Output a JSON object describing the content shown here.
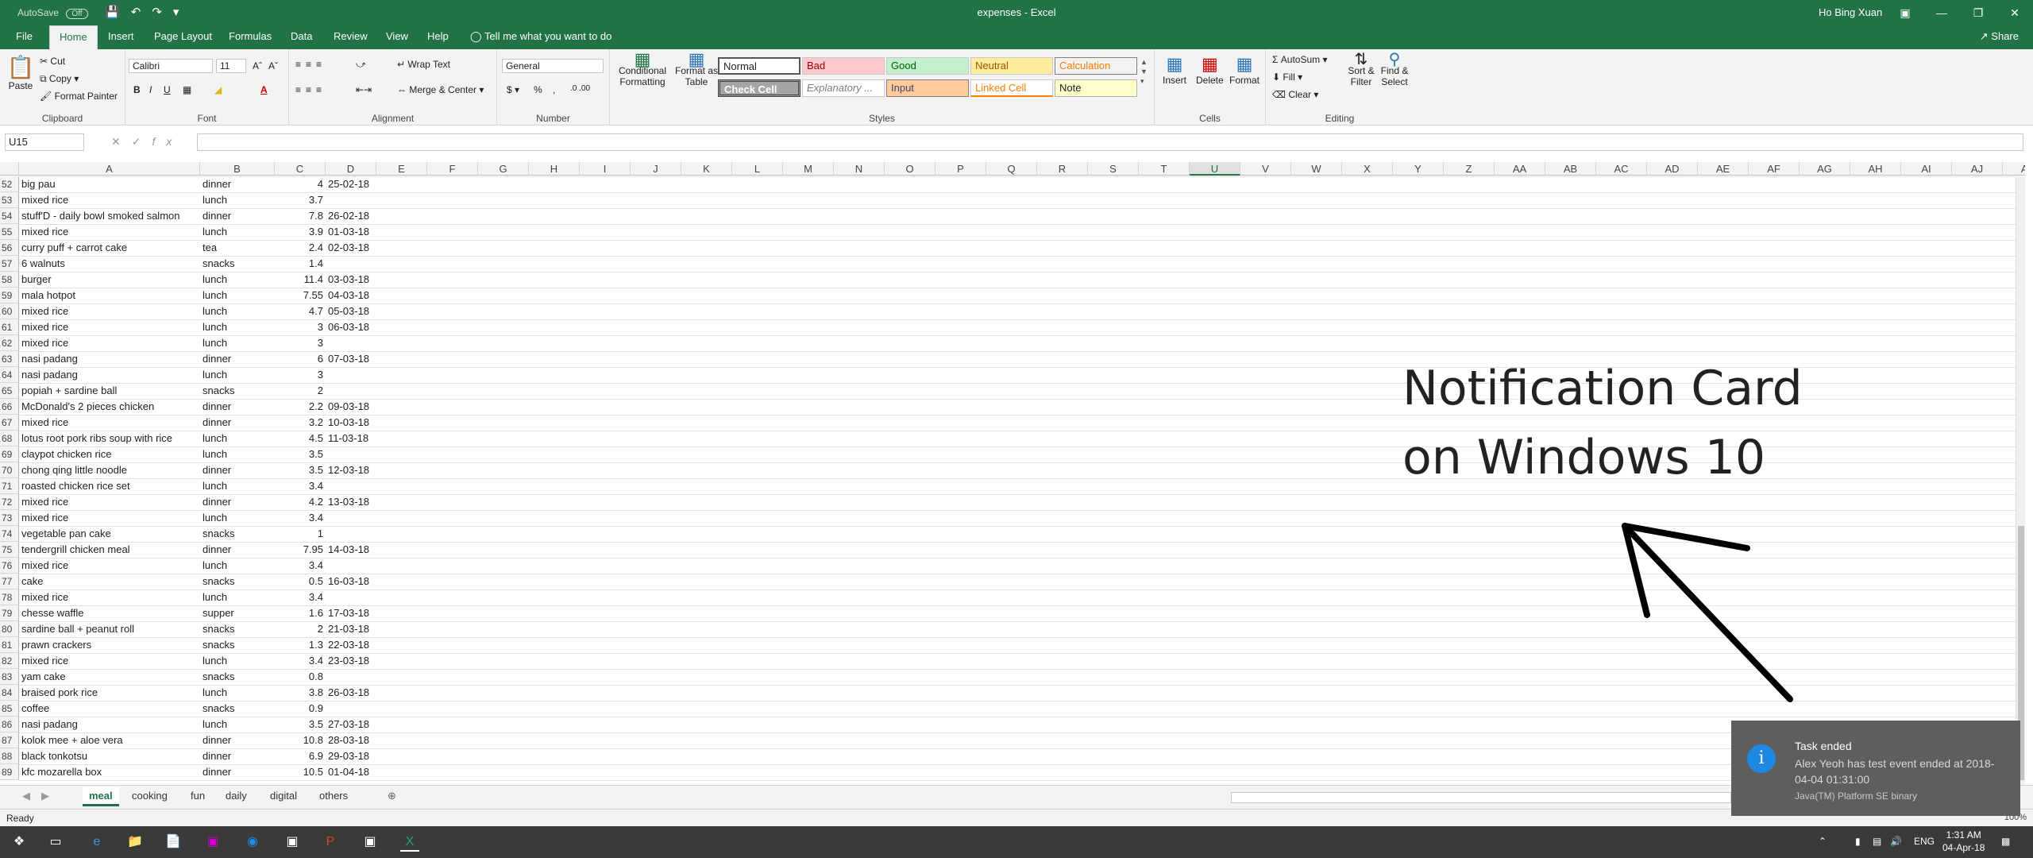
{
  "titlebar": {
    "autosave": "AutoSave",
    "autosave_state": "Off",
    "title": "expenses - Excel",
    "user": "Ho Bing Xuan"
  },
  "tabs": [
    "File",
    "Home",
    "Insert",
    "Page Layout",
    "Formulas",
    "Data",
    "Review",
    "View",
    "Help"
  ],
  "tell_me": "Tell me what you want to do",
  "share": "Share",
  "ribbon": {
    "clipboard": {
      "paste": "Paste",
      "cut": "Cut",
      "copy": "Copy",
      "format_painter": "Format Painter",
      "label": "Clipboard"
    },
    "font": {
      "name": "Calibri",
      "size": "11",
      "label": "Font"
    },
    "alignment": {
      "wrap": "Wrap Text",
      "merge": "Merge & Center",
      "label": "Alignment"
    },
    "number": {
      "format": "General",
      "label": "Number"
    },
    "styles": {
      "conditional": "Conditional Formatting",
      "format_table": "Format as Table",
      "cells": [
        "Normal",
        "Bad",
        "Good",
        "Neutral",
        "Calculation",
        "Check Cell",
        "Explanatory ...",
        "Input",
        "Linked Cell",
        "Note"
      ],
      "label": "Styles"
    },
    "cells": {
      "insert": "Insert",
      "delete": "Delete",
      "format": "Format",
      "label": "Cells"
    },
    "editing": {
      "autosum": "AutoSum",
      "fill": "Fill",
      "clear": "Clear",
      "sort": "Sort & Filter",
      "find": "Find & Select",
      "label": "Editing"
    }
  },
  "formula_bar": {
    "name_box": "U15",
    "fx": "fx",
    "formula": ""
  },
  "columns": [
    "A",
    "B",
    "C",
    "D",
    "E",
    "F",
    "G",
    "H",
    "I",
    "J",
    "K",
    "L",
    "M",
    "N",
    "O",
    "P",
    "Q",
    "R",
    "S",
    "T",
    "U",
    "V",
    "W",
    "X",
    "Y",
    "Z",
    "AA",
    "AB",
    "AC",
    "AD",
    "AE",
    "AF",
    "AG",
    "AH",
    "AI",
    "AJ",
    "AK"
  ],
  "rows": [
    {
      "n": "52",
      "a": "big pau",
      "b": "dinner",
      "c": "4",
      "d": "25-02-18"
    },
    {
      "n": "53",
      "a": "mixed rice",
      "b": "lunch",
      "c": "3.7",
      "d": ""
    },
    {
      "n": "54",
      "a": "stuff'D - daily bowl smoked salmon",
      "b": "dinner",
      "c": "7.8",
      "d": "26-02-18"
    },
    {
      "n": "55",
      "a": "mixed rice",
      "b": "lunch",
      "c": "3.9",
      "d": "01-03-18"
    },
    {
      "n": "56",
      "a": "curry puff + carrot cake",
      "b": "tea",
      "c": "2.4",
      "d": "02-03-18"
    },
    {
      "n": "57",
      "a": "6 walnuts",
      "b": "snacks",
      "c": "1.4",
      "d": ""
    },
    {
      "n": "58",
      "a": "burger",
      "b": "lunch",
      "c": "11.4",
      "d": "03-03-18"
    },
    {
      "n": "59",
      "a": "mala hotpot",
      "b": "lunch",
      "c": "7.55",
      "d": "04-03-18"
    },
    {
      "n": "60",
      "a": "mixed rice",
      "b": "lunch",
      "c": "4.7",
      "d": "05-03-18"
    },
    {
      "n": "61",
      "a": "mixed rice",
      "b": "lunch",
      "c": "3",
      "d": "06-03-18"
    },
    {
      "n": "62",
      "a": "mixed rice",
      "b": "lunch",
      "c": "3",
      "d": ""
    },
    {
      "n": "63",
      "a": "nasi padang",
      "b": "dinner",
      "c": "6",
      "d": "07-03-18"
    },
    {
      "n": "64",
      "a": "nasi padang",
      "b": "lunch",
      "c": "3",
      "d": ""
    },
    {
      "n": "65",
      "a": "popiah + sardine ball",
      "b": "snacks",
      "c": "2",
      "d": ""
    },
    {
      "n": "66",
      "a": "McDonald's 2 pieces chicken",
      "b": "dinner",
      "c": "2.2",
      "d": "09-03-18"
    },
    {
      "n": "67",
      "a": "mixed rice",
      "b": "dinner",
      "c": "3.2",
      "d": "10-03-18"
    },
    {
      "n": "68",
      "a": "lotus root pork ribs soup with rice",
      "b": "lunch",
      "c": "4.5",
      "d": "11-03-18"
    },
    {
      "n": "69",
      "a": "claypot chicken rice",
      "b": "lunch",
      "c": "3.5",
      "d": ""
    },
    {
      "n": "70",
      "a": "chong qing little noodle",
      "b": "dinner",
      "c": "3.5",
      "d": "12-03-18"
    },
    {
      "n": "71",
      "a": "roasted chicken rice set",
      "b": "lunch",
      "c": "3.4",
      "d": ""
    },
    {
      "n": "72",
      "a": "mixed rice",
      "b": "dinner",
      "c": "4.2",
      "d": "13-03-18"
    },
    {
      "n": "73",
      "a": "mixed rice",
      "b": "lunch",
      "c": "3.4",
      "d": ""
    },
    {
      "n": "74",
      "a": "vegetable pan cake",
      "b": "snacks",
      "c": "1",
      "d": ""
    },
    {
      "n": "75",
      "a": "tendergrill chicken meal",
      "b": "dinner",
      "c": "7.95",
      "d": "14-03-18"
    },
    {
      "n": "76",
      "a": "mixed rice",
      "b": "lunch",
      "c": "3.4",
      "d": ""
    },
    {
      "n": "77",
      "a": "cake",
      "b": "snacks",
      "c": "0.5",
      "d": "16-03-18"
    },
    {
      "n": "78",
      "a": "mixed rice",
      "b": "lunch",
      "c": "3.4",
      "d": ""
    },
    {
      "n": "79",
      "a": "chesse waffle",
      "b": "supper",
      "c": "1.6",
      "d": "17-03-18"
    },
    {
      "n": "80",
      "a": "sardine ball + peanut roll",
      "b": "snacks",
      "c": "2",
      "d": "21-03-18"
    },
    {
      "n": "81",
      "a": "prawn crackers",
      "b": "snacks",
      "c": "1.3",
      "d": "22-03-18"
    },
    {
      "n": "82",
      "a": "mixed rice",
      "b": "lunch",
      "c": "3.4",
      "d": "23-03-18"
    },
    {
      "n": "83",
      "a": "yam cake",
      "b": "snacks",
      "c": "0.8",
      "d": ""
    },
    {
      "n": "84",
      "a": "braised pork rice",
      "b": "lunch",
      "c": "3.8",
      "d": "26-03-18"
    },
    {
      "n": "85",
      "a": "coffee",
      "b": "snacks",
      "c": "0.9",
      "d": ""
    },
    {
      "n": "86",
      "a": "nasi padang",
      "b": "lunch",
      "c": "3.5",
      "d": "27-03-18"
    },
    {
      "n": "87",
      "a": "kolok mee + aloe vera",
      "b": "dinner",
      "c": "10.8",
      "d": "28-03-18"
    },
    {
      "n": "88",
      "a": "black tonkotsu",
      "b": "dinner",
      "c": "6.9",
      "d": "29-03-18"
    },
    {
      "n": "89",
      "a": "kfc mozarella box",
      "b": "dinner",
      "c": "10.5",
      "d": "01-04-18"
    }
  ],
  "annotation": {
    "line1": "Notification Card",
    "line2": "on Windows 10"
  },
  "toast": {
    "title": "Task ended",
    "body": "Alex Yeoh has test event ended at 2018-04-04 01:31:00",
    "app": "Java(TM) Platform SE binary"
  },
  "sheets": [
    "meal",
    "cooking",
    "fun",
    "daily",
    "digital",
    "others"
  ],
  "status": {
    "ready": "Ready",
    "zoom": "100%"
  },
  "taskbar": {
    "lang": "ENG",
    "time": "1:31 AM",
    "date": "04-Apr-18"
  },
  "colors": {
    "excel_green": "#217346",
    "toast_bg": "#5e5e5e",
    "info_blue": "#1e88e5"
  }
}
